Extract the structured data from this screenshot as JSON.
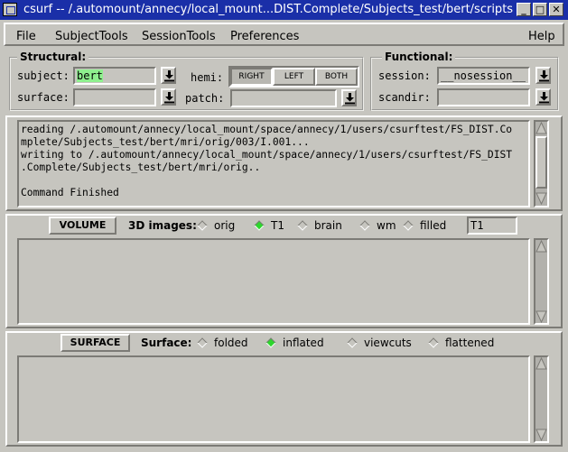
{
  "window": {
    "title": "csurf -- /.automount/annecy/local_mount...DIST.Complete/Subjects_test/bert/scripts"
  },
  "menu": {
    "file": "File",
    "subject_tools": "SubjectTools",
    "session_tools": "SessionTools",
    "preferences": "Preferences",
    "help": "Help"
  },
  "structural": {
    "legend": "Structural:",
    "subject_label": "subject:",
    "subject_value": "bert",
    "surface_label": "surface:",
    "surface_value": "",
    "hemi_label": "hemi:",
    "hemi_buttons": [
      "RIGHT",
      "LEFT",
      "BOTH"
    ],
    "hemi_selected": "RIGHT",
    "patch_label": "patch:",
    "patch_value": ""
  },
  "functional": {
    "legend": "Functional:",
    "session_label": "session:",
    "session_value": "__nosession__",
    "scandir_label": "scandir:",
    "scandir_value": ""
  },
  "log": {
    "lines": [
      "reading /.automount/annecy/local_mount/space/annecy/1/users/csurftest/FS_DIST.Co",
      "mplete/Subjects_test/bert/mri/orig/003/I.001...",
      "writing to /.automount/annecy/local_mount/space/annecy/1/users/csurftest/FS_DIST",
      ".Complete/Subjects_test/bert/mri/orig..",
      "",
      "Command Finished"
    ]
  },
  "volume": {
    "button": "VOLUME",
    "label": "3D images:",
    "options": [
      "orig",
      "T1",
      "brain",
      "wm",
      "filled"
    ],
    "selected": "T1",
    "entry_value": "T1"
  },
  "surface_panel": {
    "button": "SURFACE",
    "label": "Surface:",
    "options": [
      "folded",
      "inflated",
      "viewcuts",
      "flattened"
    ],
    "selected": "inflated"
  },
  "colors": {
    "title_bar": "#1a2fa8",
    "background": "#c6c5bf",
    "highlight": "#8ef08e",
    "radio_on": "#2dd62d"
  }
}
